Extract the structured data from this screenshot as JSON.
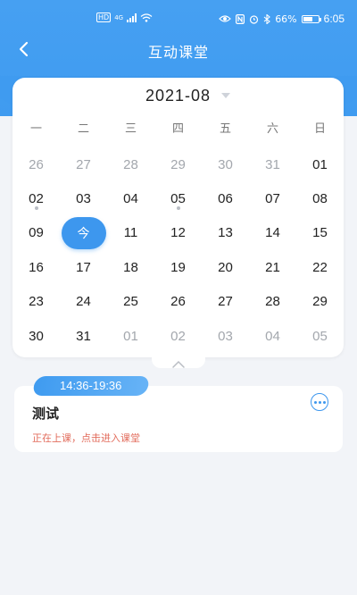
{
  "status_bar": {
    "network_badge": "HD",
    "network_type": "4G",
    "battery": "66%",
    "battery_level": 0.66,
    "time": "6:05",
    "icons": [
      "signal-icon",
      "wifi-icon",
      "eye-icon",
      "nfc-icon",
      "alarm-icon",
      "bluetooth-icon",
      "battery-icon"
    ]
  },
  "header": {
    "title": "互动课堂",
    "back_icon": "chevron-left-icon"
  },
  "calendar": {
    "month": "2021-08",
    "weekdays": [
      "一",
      "二",
      "三",
      "四",
      "五",
      "六",
      "日"
    ],
    "today_label": "今",
    "days": [
      {
        "label": "26",
        "muted": true
      },
      {
        "label": "27",
        "muted": true
      },
      {
        "label": "28",
        "muted": true
      },
      {
        "label": "29",
        "muted": true
      },
      {
        "label": "30",
        "muted": true
      },
      {
        "label": "31",
        "muted": true
      },
      {
        "label": "01",
        "muted": false
      },
      {
        "label": "02",
        "muted": false,
        "dot": true
      },
      {
        "label": "03",
        "muted": false
      },
      {
        "label": "04",
        "muted": false
      },
      {
        "label": "05",
        "muted": false,
        "dot": true
      },
      {
        "label": "06",
        "muted": false
      },
      {
        "label": "07",
        "muted": false
      },
      {
        "label": "08",
        "muted": false
      },
      {
        "label": "09",
        "muted": false
      },
      {
        "label": "今",
        "muted": false,
        "today": true
      },
      {
        "label": "11",
        "muted": false
      },
      {
        "label": "12",
        "muted": false
      },
      {
        "label": "13",
        "muted": false
      },
      {
        "label": "14",
        "muted": false
      },
      {
        "label": "15",
        "muted": false
      },
      {
        "label": "16",
        "muted": false
      },
      {
        "label": "17",
        "muted": false
      },
      {
        "label": "18",
        "muted": false
      },
      {
        "label": "19",
        "muted": false
      },
      {
        "label": "20",
        "muted": false
      },
      {
        "label": "21",
        "muted": false
      },
      {
        "label": "22",
        "muted": false
      },
      {
        "label": "23",
        "muted": false
      },
      {
        "label": "24",
        "muted": false
      },
      {
        "label": "25",
        "muted": false
      },
      {
        "label": "26",
        "muted": false
      },
      {
        "label": "27",
        "muted": false
      },
      {
        "label": "28",
        "muted": false
      },
      {
        "label": "29",
        "muted": false
      },
      {
        "label": "30",
        "muted": false
      },
      {
        "label": "31",
        "muted": false
      },
      {
        "label": "01",
        "muted": true
      },
      {
        "label": "02",
        "muted": true
      },
      {
        "label": "03",
        "muted": true
      },
      {
        "label": "04",
        "muted": true
      },
      {
        "label": "05",
        "muted": true
      }
    ]
  },
  "lesson": {
    "time": "14:36-19:36",
    "name": "测试",
    "status": "正在上课，点击进入课堂"
  },
  "colors": {
    "accent": "#3d97ee",
    "status_text": "#e26c5c",
    "muted_day": "#a3a7ad"
  }
}
